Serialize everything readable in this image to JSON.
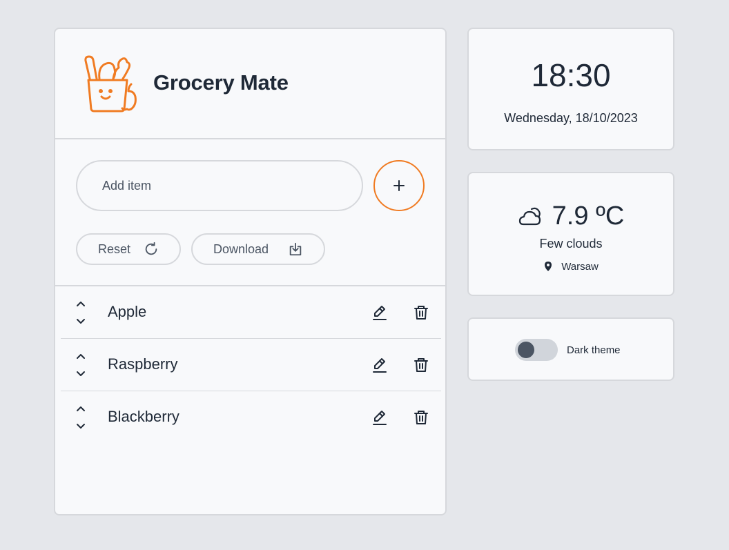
{
  "header": {
    "title": "Grocery Mate"
  },
  "add_item": {
    "placeholder": "Add item",
    "value": "",
    "add_button_icon": "plus-icon"
  },
  "actions": {
    "reset_label": "Reset",
    "reset_icon": "refresh-icon",
    "download_label": "Download",
    "download_icon": "download-icon"
  },
  "items": [
    {
      "label": "Apple"
    },
    {
      "label": "Raspberry"
    },
    {
      "label": "Blackberry"
    }
  ],
  "clock": {
    "time": "18:30",
    "date": "Wednesday, 18/10/2023"
  },
  "weather": {
    "temperature": "7.9 ºC",
    "description": "Few clouds",
    "location": "Warsaw",
    "icon": "cloud-moon-icon"
  },
  "theme": {
    "label": "Dark theme",
    "dark_enabled": false
  },
  "colors": {
    "accent": "#f07b22",
    "background": "#e5e7eb",
    "card": "#f8f9fb",
    "border": "#d6d8dc",
    "text": "#1f2937"
  }
}
